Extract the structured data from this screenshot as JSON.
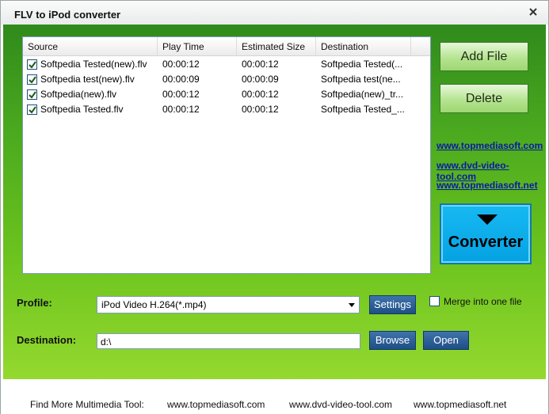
{
  "window": {
    "title": "FLV to iPod converter"
  },
  "list": {
    "columns": [
      "Source",
      "Play Time",
      "Estimated Size",
      "Destination"
    ],
    "rows": [
      {
        "checked": true,
        "source": "Softpedia Tested(new).flv",
        "play_time": "00:00:12",
        "size": "00:00:12",
        "dest": "Softpedia Tested(..."
      },
      {
        "checked": true,
        "source": "Softpedia test(new).flv",
        "play_time": "00:00:09",
        "size": "00:00:09",
        "dest": "Softpedia test(ne..."
      },
      {
        "checked": true,
        "source": "Softpedia(new).flv",
        "play_time": "00:00:12",
        "size": "00:00:12",
        "dest": "Softpedia(new)_tr..."
      },
      {
        "checked": true,
        "source": "Softpedia Tested.flv",
        "play_time": "00:00:12",
        "size": "00:00:12",
        "dest": "Softpedia Tested_..."
      }
    ]
  },
  "buttons": {
    "add_file": "Add File",
    "delete": "Delete",
    "convert": "Converter",
    "settings": "Settings",
    "browse": "Browse",
    "open": "Open"
  },
  "links": [
    "www.topmediasoft.com",
    "www.dvd-video-tool.com",
    "www.topmediasoft.net"
  ],
  "profile": {
    "label": "Profile:",
    "value": "iPod Video H.264(*.mp4)"
  },
  "destination": {
    "label": "Destination:",
    "value": "d:\\"
  },
  "merge": {
    "label": "Merge into one file",
    "checked": false
  },
  "footer": {
    "caption": "Find More Multimedia Tool:",
    "links": [
      "www.topmediasoft.com",
      "www.dvd-video-tool.com",
      "www.topmediasoft.net"
    ]
  }
}
